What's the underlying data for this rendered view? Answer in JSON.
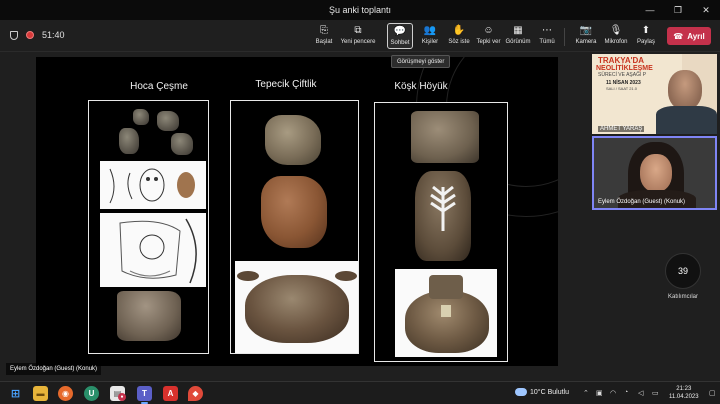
{
  "window": {
    "title": "Şu anki toplantı",
    "minimize_glyph": "—",
    "restore_glyph": "❐",
    "close_glyph": "✕"
  },
  "meeting": {
    "timer": "51:40",
    "tooltip": "Görüşmeyi göster",
    "leave_label": "Ayrıl",
    "leave_color": "#c4314b"
  },
  "toolbar": {
    "items": [
      {
        "label": "Başlat",
        "icon": "share-screen-icon",
        "glyph": "⎘"
      },
      {
        "label": "Yeni pencere",
        "icon": "new-window-icon",
        "glyph": "⧉"
      },
      {
        "label": "Sohbet",
        "icon": "chat-icon",
        "glyph": "💬"
      },
      {
        "label": "Kişiler",
        "icon": "people-icon",
        "glyph": "👥"
      },
      {
        "label": "Söz iste",
        "icon": "raise-hand-icon",
        "glyph": "✋"
      },
      {
        "label": "Tepki ver",
        "icon": "react-icon",
        "glyph": "☺"
      },
      {
        "label": "Görünüm",
        "icon": "view-icon",
        "glyph": "▦"
      },
      {
        "label": "Tümü",
        "icon": "more-icon",
        "glyph": "⋯"
      },
      {
        "label": "Kamera",
        "icon": "camera-icon",
        "glyph": "📷"
      },
      {
        "label": "Mikrofon",
        "icon": "mic-icon",
        "glyph": "🎙"
      },
      {
        "label": "Paylaş",
        "icon": "share-icon",
        "glyph": "⬆"
      }
    ]
  },
  "slide": {
    "columns": [
      {
        "title": "Hoca Çeşme"
      },
      {
        "title": "Tepecik Çiftlik"
      },
      {
        "title": "Köşk Höyük"
      }
    ]
  },
  "participants": {
    "top_tile_name": "AHMET YARAŞ",
    "poster_line1": "TRAKYA'DA",
    "poster_line2": "NEOLİTİKLEŞME",
    "poster_line3": "SÜRECİ VE AŞAĞI P",
    "poster_line4": "11 NİSAN 2023",
    "poster_line5": "SALI / SAAT 21.0",
    "speaker_name": "Eylem Özdoğan (Guest) (Konuk)",
    "count": "39",
    "count_label": "Katılımcılar",
    "stage_name": "Eylem Özdoğan (Guest) (Konuk)"
  },
  "taskbar": {
    "weather": "10°C  Bulutlu",
    "time": "21:23",
    "date": "11.04.2023",
    "apps": [
      {
        "name": "windows-icon",
        "glyph": "⊞",
        "color": "#3a78d6"
      },
      {
        "name": "file-explorer-icon",
        "glyph": "▬",
        "color": "#e7b43a"
      },
      {
        "name": "firefox-icon",
        "glyph": "◉",
        "color": "#e66a2c"
      },
      {
        "name": "uplay-icon",
        "glyph": "U",
        "color": "#2a8f6a"
      },
      {
        "name": "document-app-icon",
        "glyph": "▤",
        "color": "#e8e8e8"
      },
      {
        "name": "red-app-icon",
        "glyph": "●",
        "color": "#c4314b"
      },
      {
        "name": "teams-icon",
        "glyph": "T",
        "color": "#5b5fc7"
      },
      {
        "name": "acrobat-icon",
        "glyph": "A",
        "color": "#d8312d"
      },
      {
        "name": "pdf-icon",
        "glyph": "P",
        "color": "#e04a3a"
      },
      {
        "name": "drop-app-icon",
        "glyph": "◆",
        "color": "#d9443b"
      }
    ]
  }
}
